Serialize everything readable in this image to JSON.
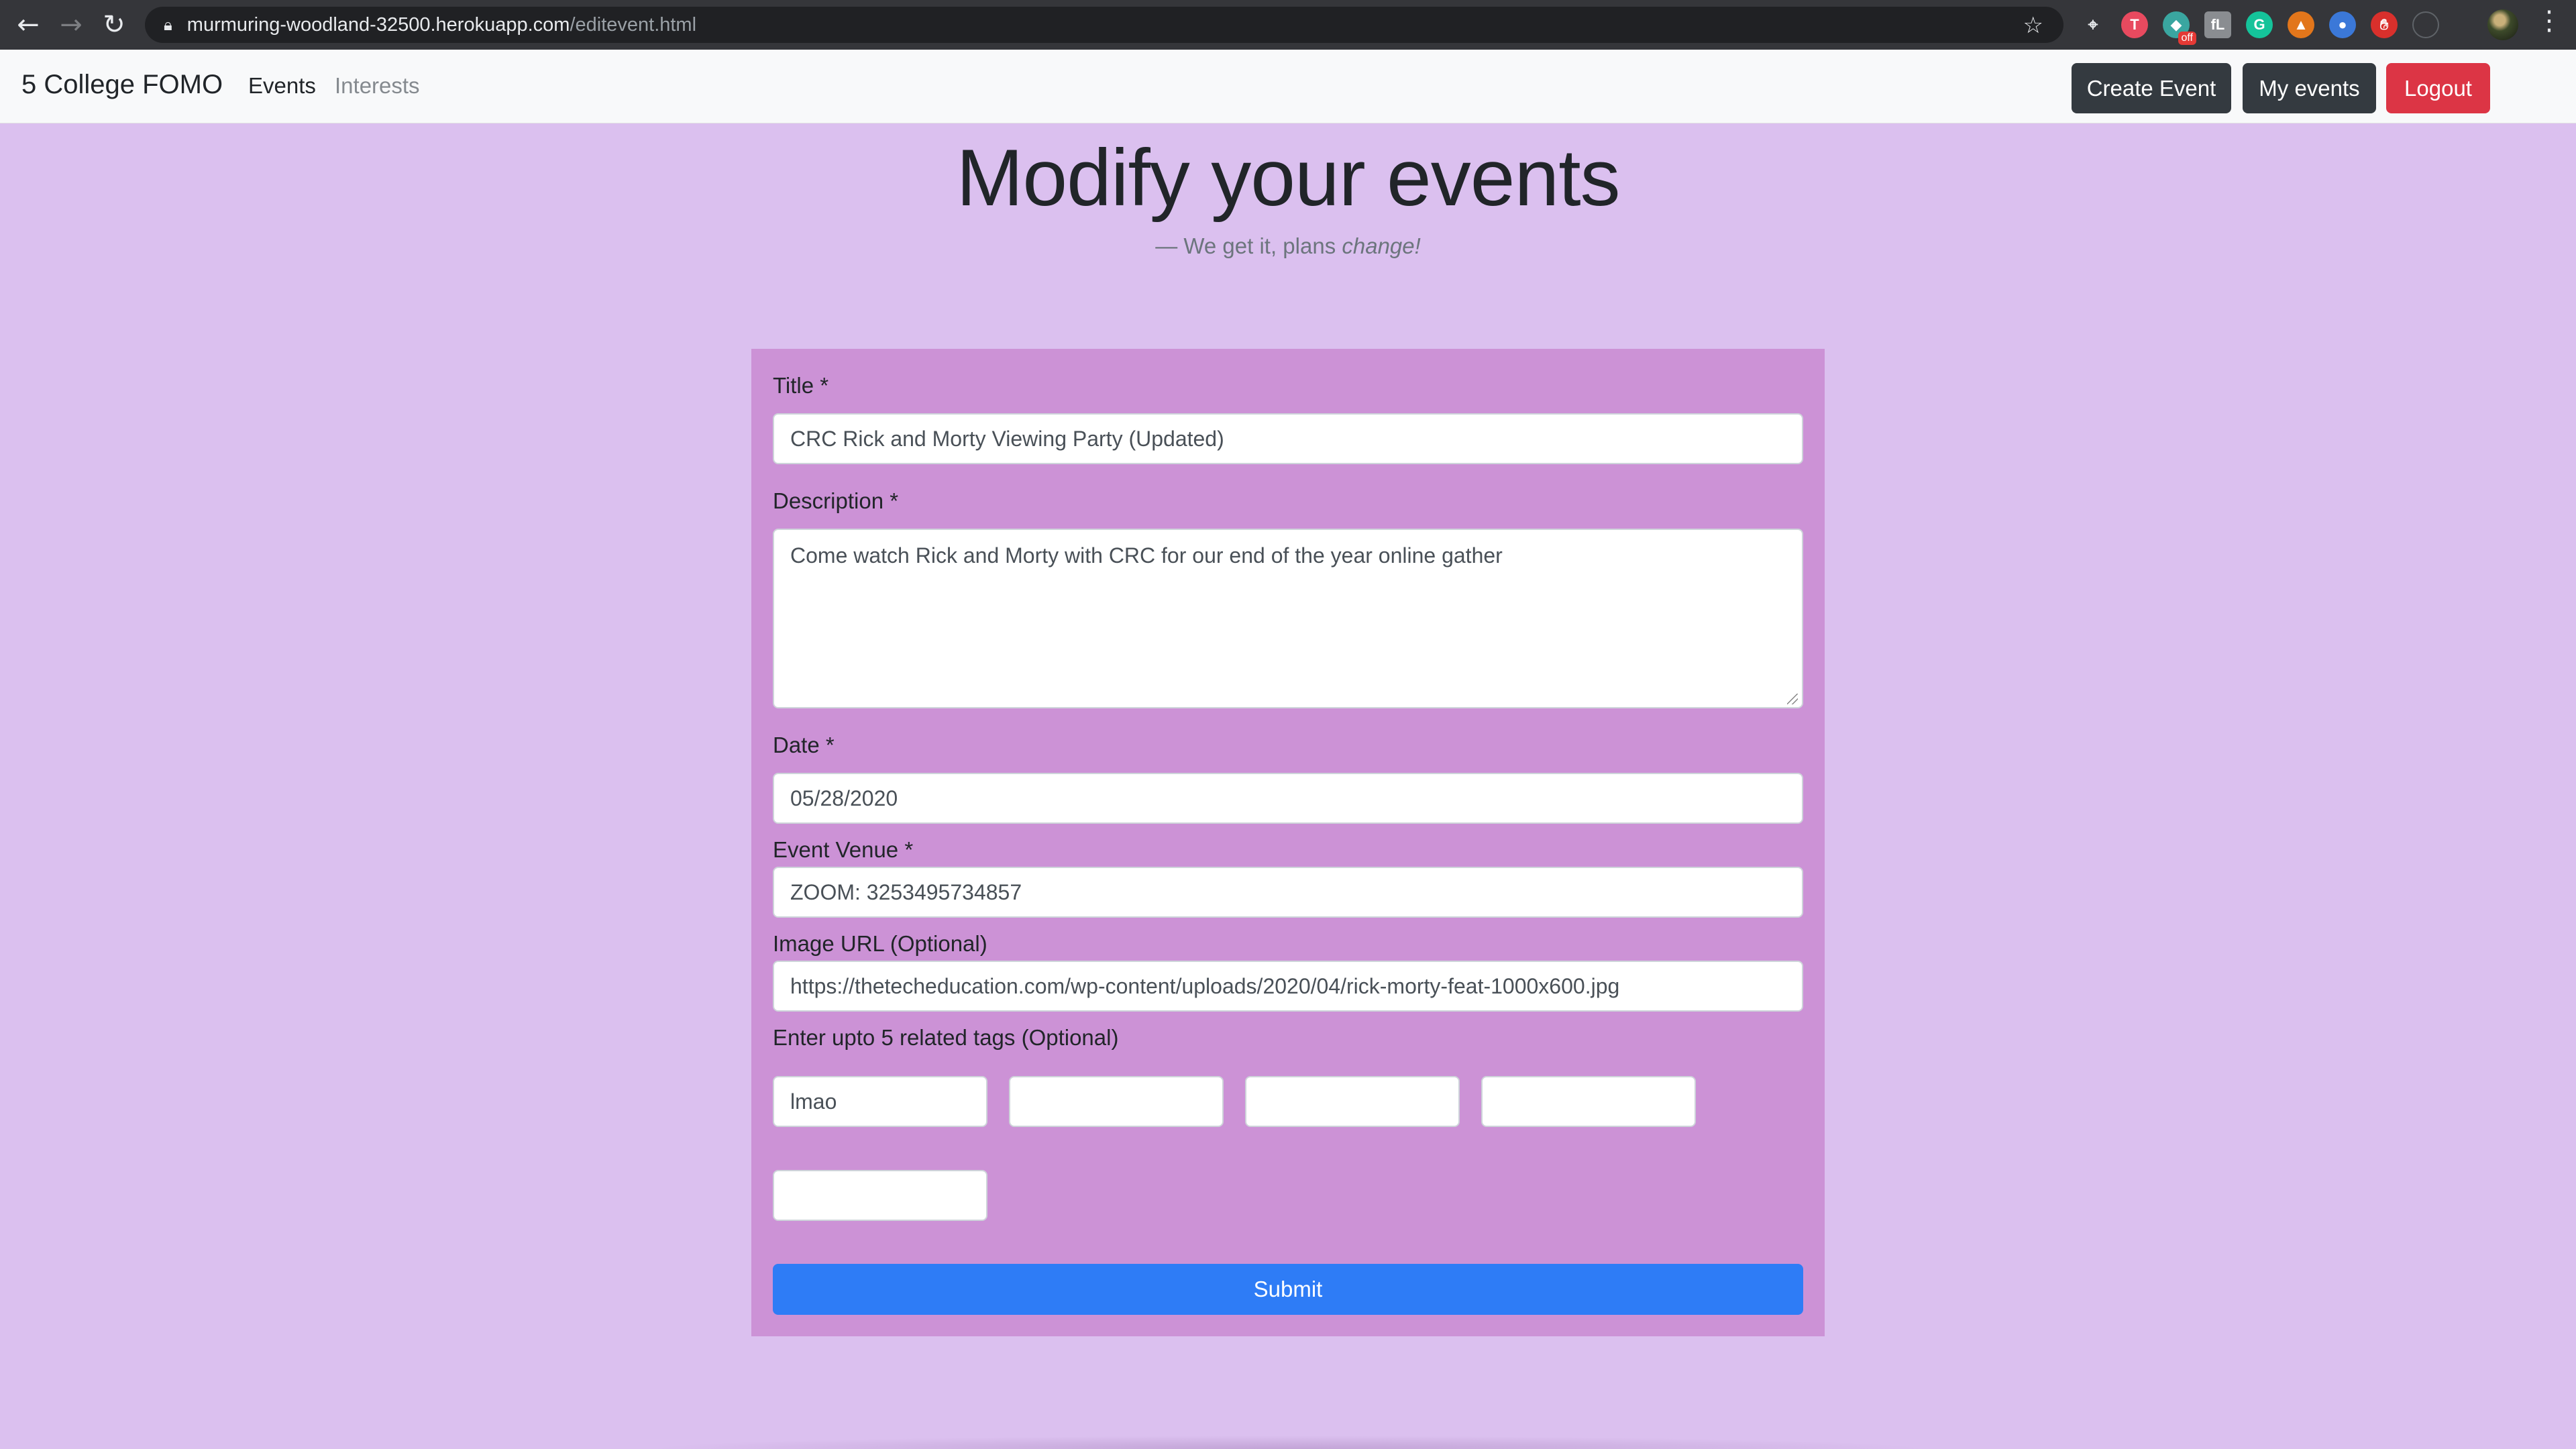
{
  "browser": {
    "url_host": "murmuring-woodland-32500.herokuapp.com",
    "url_path": "/editevent.html",
    "back_icon": "arrow-left-icon",
    "forward_icon": "arrow-right-icon",
    "reload_icon": "reload-icon",
    "extension_badge": "off"
  },
  "navbar": {
    "brand": "5 College FOMO",
    "links": [
      "Events",
      "Interests"
    ],
    "buttons": [
      "Create Event",
      "My events",
      "Logout"
    ]
  },
  "header": {
    "title": "Modify your events",
    "tagline_prefix": "— We get it, plans ",
    "tagline_emphasis": "change!"
  },
  "form": {
    "title_label": "Title *",
    "title_value": "CRC Rick and Morty Viewing Party (Updated)",
    "description_label": "Description *",
    "description_value": "Come watch Rick and Morty with CRC for our end of the year online gather",
    "date_label": "Date *",
    "date_value": "05/28/2020",
    "venue_label": "Event Venue *",
    "venue_value": "ZOOM: 3253495734857",
    "image_label": "Image URL (Optional)",
    "image_value": "https://thetecheducation.com/wp-content/uploads/2020/04/rick-morty-feat-1000x600.jpg",
    "tags_label": "Enter upto 5 related tags (Optional)",
    "tags": [
      "lmao",
      "",
      "",
      "",
      ""
    ],
    "submit_label": "Submit"
  },
  "colors": {
    "page_bg": "#dbc0ef",
    "card_bg": "#cc92d6",
    "primary": "#2e7cf6",
    "danger": "#dc3545",
    "dark": "#343a40"
  }
}
